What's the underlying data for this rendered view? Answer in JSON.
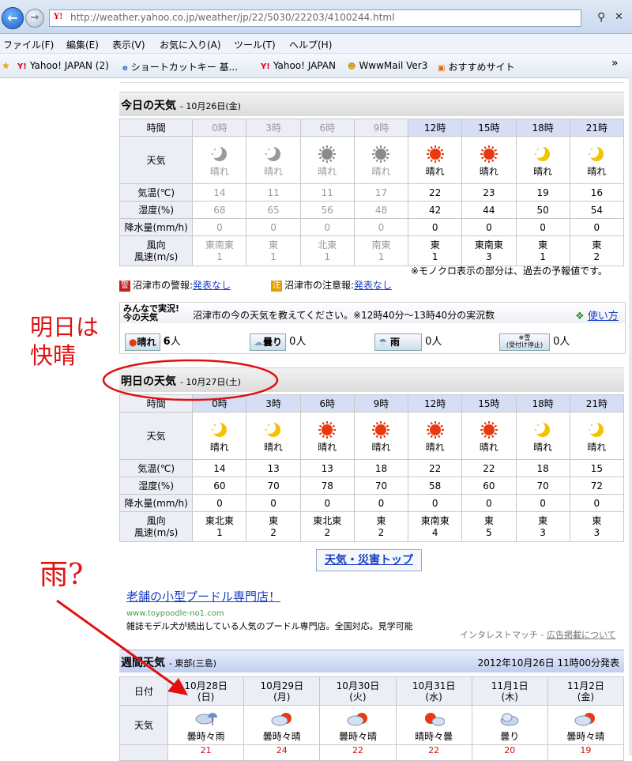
{
  "browser": {
    "url": "http://weather.yahoo.co.jp/weather/jp/22/5030/22203/4100244.html",
    "menu": [
      "ファイル(F)",
      "編集(E)",
      "表示(V)",
      "お気に入り(A)",
      "ツール(T)",
      "ヘルプ(H)"
    ],
    "favorites": [
      "Yahoo! JAPAN (2)",
      "ショートカットキー 基...",
      "Yahoo! JAPAN",
      "WwwMail Ver3",
      "おすすめサイト"
    ],
    "overflow": "»"
  },
  "today": {
    "title": "今日の天気",
    "date": "- 10月26日(金)",
    "row_labels": [
      "時間",
      "天気",
      "気温(℃)",
      "湿度(%)",
      "降水量(mm/h)",
      "風向",
      "風速(m/s)"
    ],
    "hours": [
      {
        "time": "0時",
        "icon": "moon",
        "weather": "晴れ",
        "temp": "14",
        "humidity": "68",
        "rain": "0",
        "dir": "東南東",
        "speed": "1",
        "past": true
      },
      {
        "time": "3時",
        "icon": "moon",
        "weather": "晴れ",
        "temp": "11",
        "humidity": "65",
        "rain": "0",
        "dir": "東",
        "speed": "1",
        "past": true
      },
      {
        "time": "6時",
        "icon": "sun",
        "weather": "晴れ",
        "temp": "11",
        "humidity": "56",
        "rain": "0",
        "dir": "北東",
        "speed": "1",
        "past": true
      },
      {
        "time": "9時",
        "icon": "sun",
        "weather": "晴れ",
        "temp": "17",
        "humidity": "48",
        "rain": "0",
        "dir": "南東",
        "speed": "1",
        "past": true
      },
      {
        "time": "12時",
        "icon": "sun",
        "weather": "晴れ",
        "temp": "22",
        "humidity": "42",
        "rain": "0",
        "dir": "東",
        "speed": "1",
        "past": false
      },
      {
        "time": "15時",
        "icon": "sun",
        "weather": "晴れ",
        "temp": "23",
        "humidity": "44",
        "rain": "0",
        "dir": "東南東",
        "speed": "3",
        "past": false
      },
      {
        "time": "18時",
        "icon": "moon",
        "weather": "晴れ",
        "temp": "19",
        "humidity": "50",
        "rain": "0",
        "dir": "東",
        "speed": "1",
        "past": false
      },
      {
        "time": "21時",
        "icon": "moon",
        "weather": "晴れ",
        "temp": "16",
        "humidity": "54",
        "rain": "0",
        "dir": "東",
        "speed": "2",
        "past": false
      }
    ],
    "note": "※モノクロ表示の部分は、過去の予報値です。"
  },
  "warnings": {
    "keihou_badge": "警",
    "keihou_label": "沼津市の警報:",
    "keihou_value": "発表なし",
    "chuui_badge": "注",
    "chuui_label": "沼津市の注意報:",
    "chuui_value": "発表なし"
  },
  "minna": {
    "logo_line1": "みんなで実況!",
    "logo_line2": "今の天気",
    "prompt": "沼津市の今の天気を教えてください。※12時40分～13時40分の実況数",
    "help": "使い方",
    "votes": [
      {
        "label": "晴れ",
        "count": "6",
        "unit": "人"
      },
      {
        "label": "曇り",
        "count": "0",
        "unit": "人"
      },
      {
        "label": "雨",
        "count": "0",
        "unit": "人"
      },
      {
        "label": "雪",
        "count": "0",
        "unit": "人"
      }
    ],
    "snow_sub": "(受付け停止)"
  },
  "annotations": {
    "tomorrow_line1": "明日は",
    "tomorrow_line2": "快晴",
    "rain": "雨?"
  },
  "tomorrow": {
    "title": "明日の天気",
    "date": "- 10月27日(土)",
    "hours": [
      {
        "time": "0時",
        "icon": "moon",
        "weather": "晴れ",
        "temp": "14",
        "humidity": "60",
        "rain": "0",
        "dir": "東北東",
        "speed": "1"
      },
      {
        "time": "3時",
        "icon": "moon",
        "weather": "晴れ",
        "temp": "13",
        "humidity": "70",
        "rain": "0",
        "dir": "東",
        "speed": "2"
      },
      {
        "time": "6時",
        "icon": "sun",
        "weather": "晴れ",
        "temp": "13",
        "humidity": "78",
        "rain": "0",
        "dir": "東北東",
        "speed": "2"
      },
      {
        "time": "9時",
        "icon": "sun",
        "weather": "晴れ",
        "temp": "18",
        "humidity": "70",
        "rain": "0",
        "dir": "東",
        "speed": "2"
      },
      {
        "time": "12時",
        "icon": "sun",
        "weather": "晴れ",
        "temp": "22",
        "humidity": "58",
        "rain": "0",
        "dir": "東南東",
        "speed": "4"
      },
      {
        "time": "15時",
        "icon": "sun",
        "weather": "晴れ",
        "temp": "22",
        "humidity": "60",
        "rain": "0",
        "dir": "東",
        "speed": "5"
      },
      {
        "time": "18時",
        "icon": "moon",
        "weather": "晴れ",
        "temp": "18",
        "humidity": "70",
        "rain": "0",
        "dir": "東",
        "speed": "3"
      },
      {
        "time": "21時",
        "icon": "moon",
        "weather": "晴れ",
        "temp": "15",
        "humidity": "72",
        "rain": "0",
        "dir": "東",
        "speed": "3"
      }
    ]
  },
  "top_button": "天気・災害トップ",
  "ad": {
    "title": "老舗の小型プードル専門店！",
    "url": "www.toypoodle-no1.com",
    "desc": "雑誌モデル犬が続出している人気のプードル専門店。全国対応。見学可能",
    "match": "インタレストマッチ",
    "match_sep": "-",
    "match_link": "広告掲載について"
  },
  "weekly": {
    "title": "週間天気",
    "region": "- 東部(三島)",
    "issued": "2012年10月26日 11時00分発表",
    "row_labels": [
      "日付",
      "天気"
    ],
    "days": [
      {
        "date": "10月28日",
        "dow": "(日)",
        "icon": "rain",
        "weather": "曇時々雨",
        "temp": "21"
      },
      {
        "date": "10月29日",
        "dow": "(月)",
        "icon": "cloudsun",
        "weather": "曇時々晴",
        "temp": "24"
      },
      {
        "date": "10月30日",
        "dow": "(火)",
        "icon": "cloudsun",
        "weather": "曇時々晴",
        "temp": "22"
      },
      {
        "date": "10月31日",
        "dow": "(水)",
        "icon": "suncloud",
        "weather": "晴時々曇",
        "temp": "22"
      },
      {
        "date": "11月1日",
        "dow": "(木)",
        "icon": "cloud",
        "weather": "曇り",
        "temp": "20"
      },
      {
        "date": "11月2日",
        "dow": "(金)",
        "icon": "cloudsun",
        "weather": "曇時々晴",
        "temp": "19"
      }
    ]
  },
  "colors": {
    "link": "#1a3ec0",
    "annotation": "#e01010",
    "sun": "#e83a10",
    "moon": "#f3c200"
  }
}
